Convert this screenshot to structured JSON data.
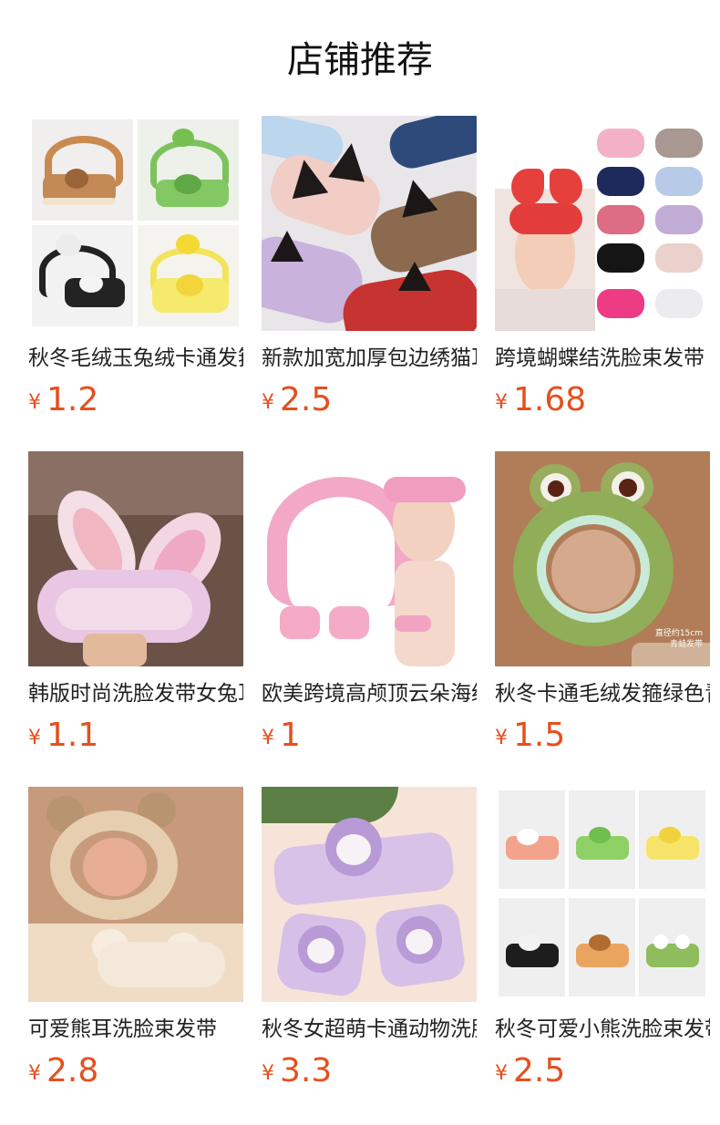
{
  "header": {
    "title": "店铺推荐"
  },
  "products": [
    {
      "name": "秋冬毛绒玉兔绒卡通发箍洗脸束发带",
      "currency": "¥",
      "price": "1.2",
      "icon": "plush-headband-collage-image"
    },
    {
      "name": "新款加宽加厚包边绣猫耳朵发带",
      "currency": "¥",
      "price": "2.5",
      "icon": "cat-ear-headband-image"
    },
    {
      "name": "跨境蝴蝶结洗脸束发带",
      "currency": "¥",
      "price": "1.68",
      "icon": "bow-headband-image"
    },
    {
      "name": "韩版时尚洗脸发带女兔耳朵",
      "currency": "¥",
      "price": "1.1",
      "icon": "bunny-ear-headband-image"
    },
    {
      "name": "欧美跨境高颅顶云朵海绵发箍",
      "currency": "¥",
      "price": "1",
      "icon": "sponge-headband-image"
    },
    {
      "name": "秋冬卡通毛绒发箍绿色青蛙",
      "currency": "¥",
      "price": "1.5",
      "icon": "frog-headband-image",
      "overlay_lines": [
        "直径约15cm",
        "青蛙发带"
      ]
    },
    {
      "name": "可爱熊耳洗脸束发带",
      "currency": "¥",
      "price": "2.8",
      "icon": "bear-ear-headband-image"
    },
    {
      "name": "秋冬女超萌卡通动物洗脸发带",
      "currency": "¥",
      "price": "3.3",
      "icon": "kuromi-headband-image"
    },
    {
      "name": "秋冬可爱小熊洗脸束发带",
      "currency": "¥",
      "price": "2.5",
      "icon": "bear-headband-collage-image"
    }
  ],
  "colors": {
    "price": "#e4501e",
    "text": "#222222",
    "background": "#ffffff"
  }
}
